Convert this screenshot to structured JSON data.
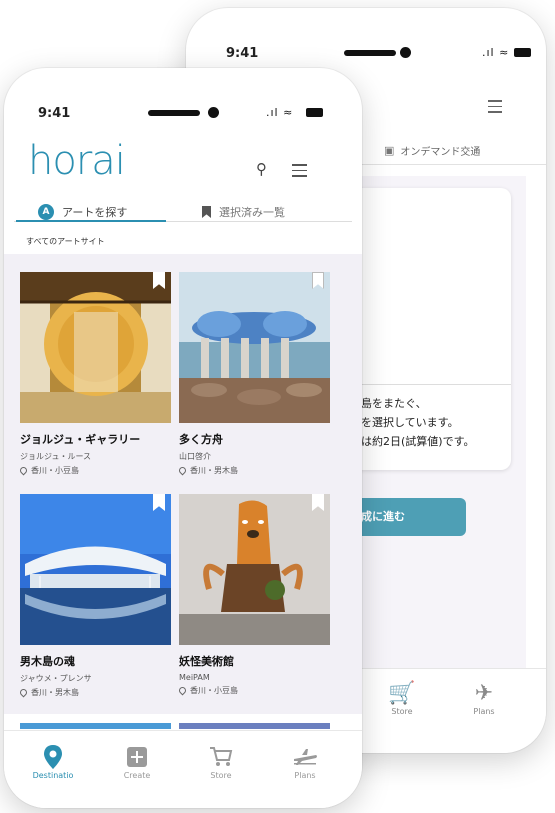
{
  "back_phone": {
    "status_time": "9:41",
    "tab_transport": "オンデマンド交通",
    "description_lines": [
      "の島をまたぐ、",
      "トを選択しています。",
      "数は約2日(試算値)です。"
    ],
    "cta_label": "作成に進む",
    "nav": [
      {
        "label": "Store",
        "icon": "cart-icon"
      },
      {
        "label": "Plans",
        "icon": "plane-icon"
      }
    ]
  },
  "front_phone": {
    "status_time": "9:41",
    "logo": "horai",
    "tabs": [
      {
        "label": "アートを探す",
        "icon": "art-icon",
        "active": true
      },
      {
        "label": "選択済み一覧",
        "icon": "bookmark-icon",
        "active": false
      }
    ],
    "section_title": "すべてのアートサイト",
    "items": [
      {
        "name": "ジョルジュ・ギャラリー",
        "artist": "ジョルジュ・ルース",
        "location": "香川・小豆島",
        "bookmark_color": "#ffffff"
      },
      {
        "name": "多く方舟",
        "artist": "山口啓介",
        "location": "香川・男木島",
        "bookmark_color": "#ffffff"
      },
      {
        "name": "男木島の魂",
        "artist": "ジャウメ・プレンサ",
        "location": "香川・男木島",
        "bookmark_color": "#ffffff"
      },
      {
        "name": "妖怪美術館",
        "artist": "MeiPAM",
        "location": "香川・小豆島",
        "bookmark_color": "#ffffff"
      }
    ],
    "nav": [
      {
        "label": "Destinatio",
        "icon": "location-pin-icon",
        "active": true
      },
      {
        "label": "Create",
        "icon": "plus-square-icon",
        "active": false
      },
      {
        "label": "Store",
        "icon": "cart-icon",
        "active": false
      },
      {
        "label": "Plans",
        "icon": "plane-icon",
        "active": false
      }
    ],
    "accent_color": "#2b8fb1"
  }
}
